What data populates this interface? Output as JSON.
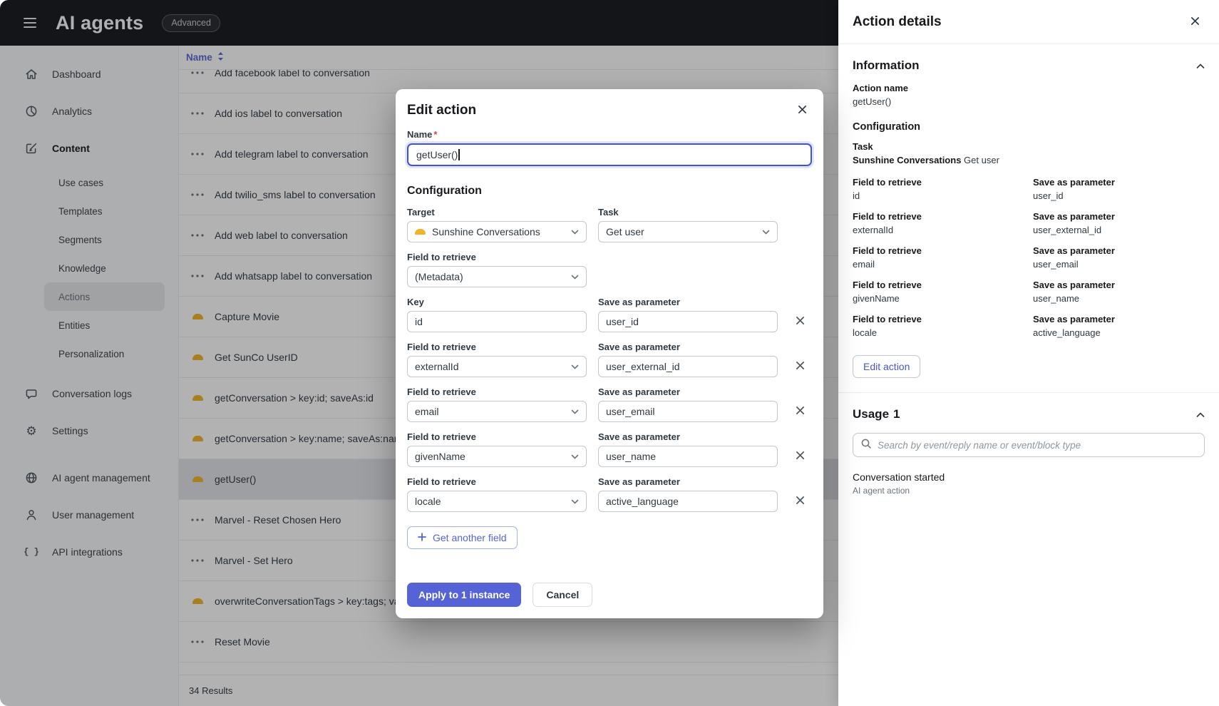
{
  "colors": {
    "accent": "#5663d7",
    "focus_blue": "#3d53de",
    "sunshine_yellow": "#f0b429",
    "required_red": "#d93f4c",
    "topbar_bg": "#16181b"
  },
  "topbar": {
    "title": "AI agents",
    "badge": "Advanced"
  },
  "sidebar": {
    "items_top": [
      {
        "label": "Dashboard",
        "icon": "home-icon"
      },
      {
        "label": "Analytics",
        "icon": "pie-chart-icon"
      },
      {
        "label": "Content",
        "icon": "pen-icon",
        "active": true
      }
    ],
    "subitems": [
      {
        "label": "Use cases"
      },
      {
        "label": "Templates"
      },
      {
        "label": "Segments"
      },
      {
        "label": "Knowledge"
      },
      {
        "label": "Actions",
        "active": true
      },
      {
        "label": "Entities"
      },
      {
        "label": "Personalization"
      }
    ],
    "items_bottom": [
      {
        "label": "Conversation logs",
        "icon": "chat-icon"
      },
      {
        "label": "Settings",
        "icon": "gear-icon"
      },
      {
        "label": "AI agent management",
        "icon": "globe-icon",
        "gap": true
      },
      {
        "label": "User management",
        "icon": "person-icon"
      },
      {
        "label": "API integrations",
        "icon": "braces-icon"
      }
    ]
  },
  "table": {
    "name_header": "Name",
    "results_text": "34 Results",
    "rows": [
      {
        "label": "Add facebook label to conversation",
        "icon": "dots-icon"
      },
      {
        "label": "Add ios label to conversation",
        "icon": "dots-icon"
      },
      {
        "label": "Add telegram label to conversation",
        "icon": "dots-icon"
      },
      {
        "label": "Add twilio_sms label to conversation",
        "icon": "dots-icon"
      },
      {
        "label": "Add web label to conversation",
        "icon": "dots-icon"
      },
      {
        "label": "Add whatsapp label to conversation",
        "icon": "dots-icon"
      },
      {
        "label": "Capture Movie",
        "icon": "sunshine-icon"
      },
      {
        "label": "Get SunCo UserID",
        "icon": "sunshine-icon"
      },
      {
        "label": "getConversation > key:id; saveAs:id",
        "icon": "sunshine-icon"
      },
      {
        "label": "getConversation > key:name; saveAs:name, l",
        "icon": "sunshine-icon"
      },
      {
        "label": "getUser()",
        "icon": "sunshine-icon",
        "selected": true
      },
      {
        "label": "Marvel - Reset Chosen Hero",
        "icon": "dots-icon"
      },
      {
        "label": "Marvel - Set Hero",
        "icon": "dots-icon"
      },
      {
        "label": "overwriteConversationTags > key:tags; value",
        "icon": "sunshine-icon"
      },
      {
        "label": "Reset Movie",
        "icon": "dots-icon"
      }
    ]
  },
  "modal": {
    "title": "Edit action",
    "name_label": "Name",
    "required_mark": "*",
    "name_value": "getUser()",
    "configuration_heading": "Configuration",
    "target_label": "Target",
    "target_value": "Sunshine Conversations",
    "task_label": "Task",
    "task_value": "Get user",
    "field_label": "Field to retrieve",
    "metadata_value": "(Metadata)",
    "key_label": "Key",
    "key_value": "id",
    "save_label": "Save as parameter",
    "key_param_value": "user_id",
    "fields": [
      {
        "field": "externalId",
        "param": "user_external_id"
      },
      {
        "field": "email",
        "param": "user_email"
      },
      {
        "field": "givenName",
        "param": "user_name"
      },
      {
        "field": "locale",
        "param": "active_language"
      }
    ],
    "add_field_label": "Get another field",
    "apply_label": "Apply to 1 instance",
    "cancel_label": "Cancel"
  },
  "details_panel": {
    "title": "Action details",
    "information_heading": "Information",
    "action_name_label": "Action name",
    "action_name_value": "getUser()",
    "configuration_heading": "Configuration",
    "task_label": "Task",
    "task_target": "Sunshine Conversations",
    "task_value": "Get user",
    "field_label": "Field to retrieve",
    "param_label": "Save as parameter",
    "fields": [
      {
        "field": "id",
        "param": "user_id"
      },
      {
        "field": "externalId",
        "param": "user_external_id"
      },
      {
        "field": "email",
        "param": "user_email"
      },
      {
        "field": "givenName",
        "param": "user_name"
      },
      {
        "field": "locale",
        "param": "active_language"
      }
    ],
    "edit_button_label": "Edit action",
    "usage_heading": "Usage",
    "usage_count": "1",
    "search_placeholder": "Search by event/reply name or event/block type",
    "usage_item_title": "Conversation started",
    "usage_item_subtitle": "AI agent action"
  }
}
